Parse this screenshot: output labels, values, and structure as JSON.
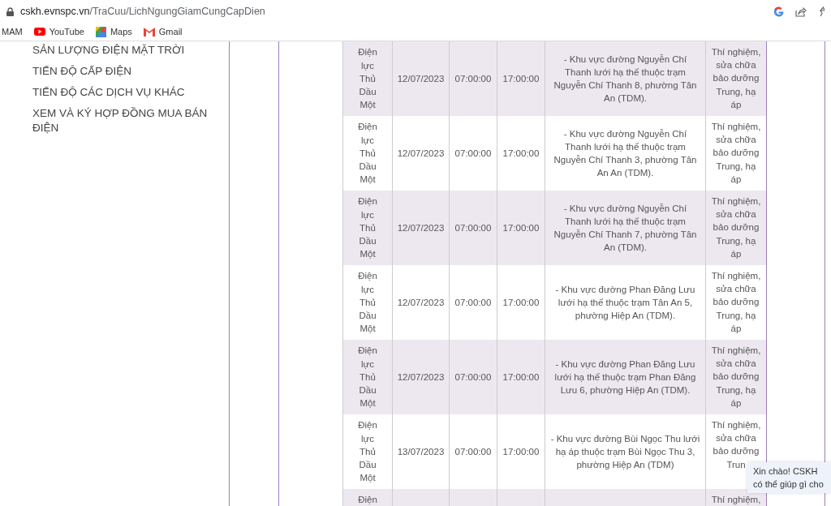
{
  "browser": {
    "url_host": "cskh.evnspc.vn",
    "url_path": "/TraCuu/LichNgungGiamCungCapDien",
    "bookmarks": [
      {
        "label": "MAM",
        "kind": "plain"
      },
      {
        "label": "YouTube",
        "kind": "youtube"
      },
      {
        "label": "Maps",
        "kind": "maps"
      },
      {
        "label": "Gmail",
        "kind": "gmail"
      }
    ]
  },
  "sidebar": {
    "items": [
      {
        "label": "SẢN LƯỢNG ĐIỆN MẶT TRỜI"
      },
      {
        "label": "TIẾN ĐỘ CẤP ĐIỆN"
      },
      {
        "label": "TIẾN ĐỘ CÁC DỊCH VỤ KHÁC"
      },
      {
        "label": "XEM VÀ KÝ HỢP ĐỒNG MUA BÁN ĐIỆN"
      }
    ]
  },
  "table": {
    "rows": [
      {
        "unit": "Điện lực Thủ Dầu Một",
        "date": "12/07/2023",
        "start": "07:00:00",
        "end": "17:00:00",
        "area": "- Khu vực đường Nguyễn Chí Thanh lưới hạ thế thuộc trạm Nguyễn Chí Thanh 8, phường Tân An (TDM).",
        "reason": "Thí nghiệm, sửa chữa bảo dưỡng Trung, hạ áp"
      },
      {
        "unit": "Điện lực Thủ Dầu Một",
        "date": "12/07/2023",
        "start": "07:00:00",
        "end": "17:00:00",
        "area": "- Khu vực đường Nguyễn Chí Thanh lưới hạ thế thuộc trạm Nguyễn Chí Thanh 3, phường Tân An An (TDM).",
        "reason": "Thí nghiệm, sửa chữa bảo dưỡng Trung, hạ áp"
      },
      {
        "unit": "Điện lực Thủ Dầu Một",
        "date": "12/07/2023",
        "start": "07:00:00",
        "end": "17:00:00",
        "area": "- Khu vực đường Nguyễn Chí Thanh lưới hạ thế thuộc trạm Nguyễn Chí Thanh 7, phường Tân An (TDM).",
        "reason": "Thí nghiệm, sửa chữa bảo dưỡng Trung, hạ áp"
      },
      {
        "unit": "Điện lực Thủ Dầu Một",
        "date": "12/07/2023",
        "start": "07:00:00",
        "end": "17:00:00",
        "area": "- Khu vực đường Phan Đăng Lưu lưới hạ thế thuộc trạm Tân An 5, phường Hiệp An (TDM).",
        "reason": "Thí nghiệm, sửa chữa bảo dưỡng Trung, hạ áp"
      },
      {
        "unit": "Điện lực Thủ Dầu Một",
        "date": "12/07/2023",
        "start": "07:00:00",
        "end": "17:00:00",
        "area": "- Khu vực đường Phan Đăng Lưu lưới hạ thế thuộc trạm Phan Đăng Lưu 6, phường Hiệp An (TDM).",
        "reason": "Thí nghiệm, sửa chữa bảo dưỡng Trung, hạ áp"
      },
      {
        "unit": "Điện lực Thủ Dầu Một",
        "date": "13/07/2023",
        "start": "07:00:00",
        "end": "17:00:00",
        "area": "- Khu vực đường Bùi Ngọc Thu lưới hạ áp thuộc trạm Bùi Ngọc Thu 3, phường Hiệp An (TDM)",
        "reason": "Thí nghiệm, sửa chữa bảo dưỡng Trun"
      },
      {
        "unit": "Điện",
        "reason": "Thí nghiệm,"
      }
    ]
  },
  "chat_popup": {
    "lines": [
      "Xin chào! CSKH",
      "có thể giúp gì cho"
    ]
  }
}
